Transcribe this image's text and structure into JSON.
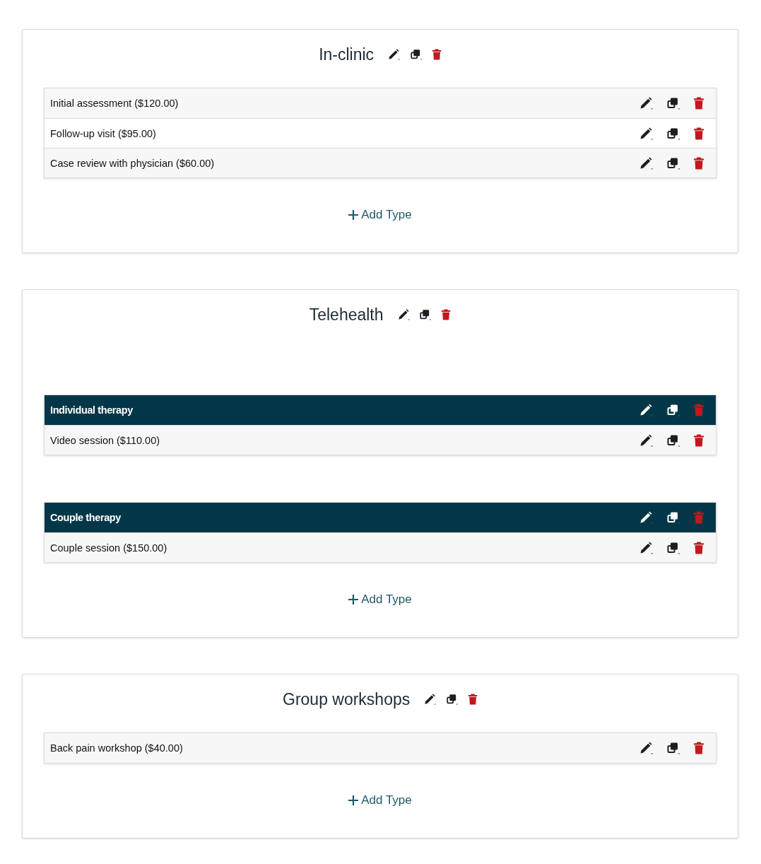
{
  "categories": [
    {
      "title": "In-clinic",
      "sections": [
        {
          "items": [
            "Initial assessment ($120.00)",
            "Follow-up visit ($95.00)",
            "Case review with physician ($60.00)"
          ]
        }
      ],
      "add_label": "Add Type"
    },
    {
      "title": "Telehealth",
      "sections": [
        {
          "heading": "Individual therapy",
          "items": [
            "Video session ($110.00)"
          ]
        },
        {
          "heading": "Couple therapy",
          "items": [
            "Couple session ($150.00)"
          ]
        }
      ],
      "add_label": "Add Type"
    },
    {
      "title": "Group workshops",
      "sections": [
        {
          "items": [
            "Back pain workshop ($40.00)"
          ]
        }
      ],
      "add_label": "Add Type"
    }
  ]
}
